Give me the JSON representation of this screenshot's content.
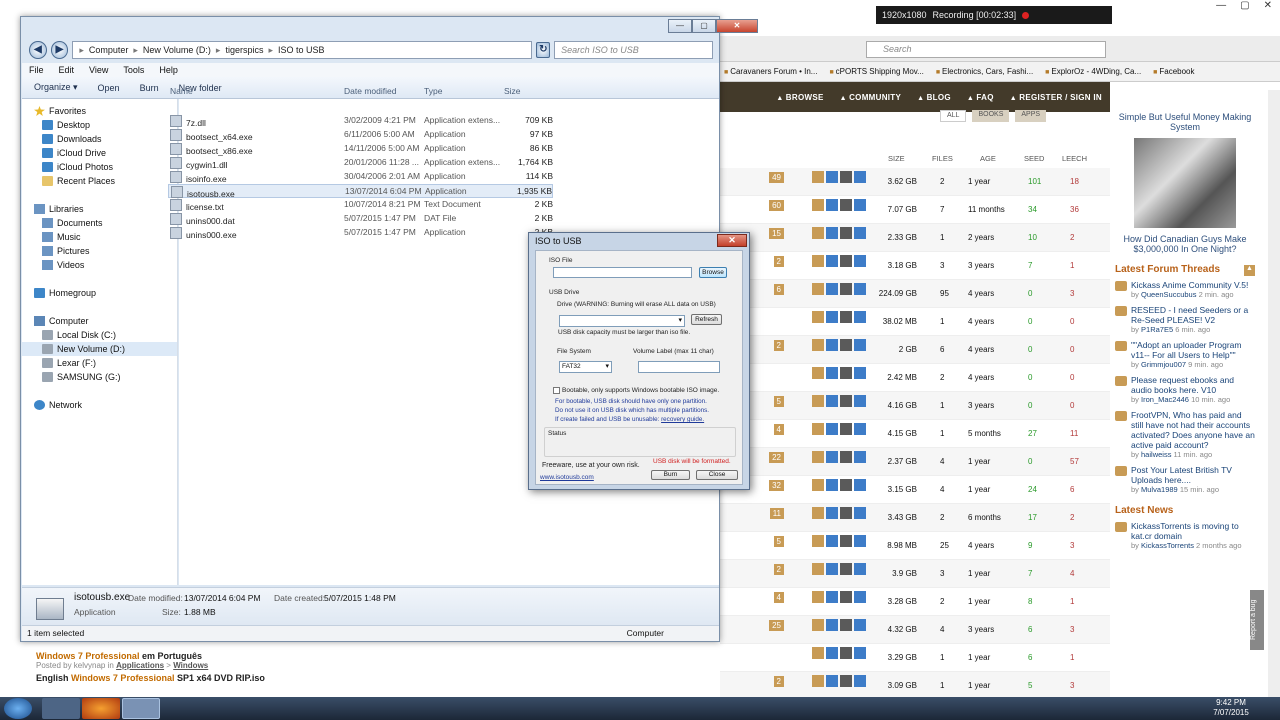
{
  "recorder": {
    "resolution": "1920x1080",
    "recording": "Recording [00:02:33]"
  },
  "browser": {
    "search_placeholder": "Search",
    "bookmarks": [
      "Caravaners Forum • In...",
      "cPORTS Shipping Mov...",
      "Electronics, Cars, Fashi...",
      "ExplorOz - 4WDing, Ca...",
      "Facebook"
    ],
    "nav": [
      "BROWSE",
      "COMMUNITY",
      "BLOG",
      "FAQ",
      "REGISTER / SIGN IN"
    ],
    "tabs": [
      "ALL",
      "BOOKS",
      "APPS"
    ],
    "columns": {
      "size": "SIZE",
      "files": "FILES",
      "age": "AGE",
      "seed": "SEED",
      "leech": "LEECH"
    },
    "torrents": [
      {
        "badge": "49",
        "size": "3.62 GB",
        "files": "2",
        "age": "1 year",
        "seed": "101",
        "leech": "18"
      },
      {
        "badge": "60",
        "size": "7.07 GB",
        "files": "7",
        "age": "11 months",
        "seed": "34",
        "leech": "36"
      },
      {
        "badge": "15",
        "size": "2.33 GB",
        "files": "1",
        "age": "2 years",
        "seed": "10",
        "leech": "2"
      },
      {
        "badge": "2",
        "size": "3.18 GB",
        "files": "3",
        "age": "3 years",
        "seed": "7",
        "leech": "1"
      },
      {
        "badge": "6",
        "size": "224.09 GB",
        "files": "95",
        "age": "4 years",
        "seed": "0",
        "leech": "3"
      },
      {
        "badge": "",
        "size": "38.02 MB",
        "files": "1",
        "age": "4 years",
        "seed": "0",
        "leech": "0"
      },
      {
        "badge": "2",
        "size": "2 GB",
        "files": "6",
        "age": "4 years",
        "seed": "0",
        "leech": "0"
      },
      {
        "badge": "",
        "size": "2.42 MB",
        "files": "2",
        "age": "4 years",
        "seed": "0",
        "leech": "0"
      },
      {
        "badge": "5",
        "size": "4.16 GB",
        "files": "1",
        "age": "3 years",
        "seed": "0",
        "leech": "0"
      },
      {
        "badge": "4",
        "size": "4.15 GB",
        "files": "1",
        "age": "5 months",
        "seed": "27",
        "leech": "11"
      },
      {
        "badge": "22",
        "size": "2.37 GB",
        "files": "4",
        "age": "1 year",
        "seed": "0",
        "leech": "57"
      },
      {
        "badge": "32",
        "size": "3.15 GB",
        "files": "4",
        "age": "1 year",
        "seed": "24",
        "leech": "6"
      },
      {
        "badge": "11",
        "size": "3.43 GB",
        "files": "2",
        "age": "6 months",
        "seed": "17",
        "leech": "2"
      },
      {
        "badge": "5",
        "size": "8.98 MB",
        "files": "25",
        "age": "4 years",
        "seed": "9",
        "leech": "3"
      },
      {
        "badge": "2",
        "size": "3.9 GB",
        "files": "3",
        "age": "1 year",
        "seed": "7",
        "leech": "4"
      },
      {
        "badge": "4",
        "size": "3.28 GB",
        "files": "2",
        "age": "1 year",
        "seed": "8",
        "leech": "1"
      },
      {
        "badge": "25",
        "size": "4.32 GB",
        "files": "4",
        "age": "3 years",
        "seed": "6",
        "leech": "3"
      },
      {
        "badge": "",
        "size": "3.29 GB",
        "files": "1",
        "age": "1 year",
        "seed": "6",
        "leech": "1"
      },
      {
        "badge": "2",
        "size": "3.09 GB",
        "files": "1",
        "age": "1 year",
        "seed": "5",
        "leech": "3"
      }
    ],
    "bottom_items": [
      {
        "title_pre": "",
        "title_hl": "Windows 7 Professional",
        "title_post": " em Português",
        "posted": "Posted by kelvynap in",
        "cat1": "Applications",
        "cat2": "Windows"
      },
      {
        "title_pre": "English ",
        "title_hl": "Windows 7 Professional",
        "title_post": " SP1 x64 DVD RIP.iso",
        "posted": "",
        "cat1": "",
        "cat2": ""
      }
    ],
    "ad": {
      "top": "Simple But Useful Money Making System",
      "bottom": "How Did Canadian Guys Make $3,000,000 In One Night?"
    },
    "forum_heading": "Latest Forum Threads",
    "threads": [
      {
        "title": "Kickass Anime Community V.5!",
        "user": "QueenSuccubus",
        "time": "2 min. ago"
      },
      {
        "title": "RESEED - I need Seeders or a Re-Seed PLEASE! V2",
        "user": "P1Ra7E5",
        "time": "6 min. ago"
      },
      {
        "title": "\"\"Adopt an uploader Program v11-- For all Users to Help\"\"",
        "user": "Grimmjou007",
        "time": "9 min. ago"
      },
      {
        "title": "Please request ebooks and audio books here. V10",
        "user": "Iron_Mac2446",
        "time": "10 min. ago"
      },
      {
        "title": "FrootVPN, Who has paid and still have not had their accounts activated? Does anyone have an active paid account?",
        "user": "hailweiss",
        "time": "11 min. ago"
      },
      {
        "title": "Post Your Latest British TV Uploads here....",
        "user": "Mulva1989",
        "time": "15 min. ago"
      }
    ],
    "news_heading": "Latest News",
    "news": [
      {
        "title": "KickassTorrents is moving to kat.cr domain",
        "user": "KickassTorrents",
        "time": "2 months ago"
      }
    ],
    "report_bug": "Report a bug"
  },
  "explorer": {
    "address": [
      "Computer",
      "New Volume (D:)",
      "tigerspics",
      "ISO to USB"
    ],
    "search_placeholder": "Search ISO to USB",
    "menu": [
      "File",
      "Edit",
      "View",
      "Tools",
      "Help"
    ],
    "toolbar": [
      "Organize ▾",
      "Open",
      "Burn",
      "New folder"
    ],
    "nav": [
      {
        "label": "Favorites",
        "icon": "star-icon",
        "indent": 0
      },
      {
        "label": "Desktop",
        "icon": "desktop-icon",
        "indent": 1
      },
      {
        "label": "Downloads",
        "icon": "downloads-icon",
        "indent": 1
      },
      {
        "label": "iCloud Drive",
        "icon": "cloud-icon",
        "indent": 1
      },
      {
        "label": "iCloud Photos",
        "icon": "cloud-icon",
        "indent": 1
      },
      {
        "label": "Recent Places",
        "icon": "recent-icon",
        "indent": 1
      },
      {
        "label": "",
        "icon": "",
        "indent": 0
      },
      {
        "label": "Libraries",
        "icon": "library-icon",
        "indent": 0
      },
      {
        "label": "Documents",
        "icon": "library-icon",
        "indent": 1
      },
      {
        "label": "Music",
        "icon": "library-icon",
        "indent": 1
      },
      {
        "label": "Pictures",
        "icon": "library-icon",
        "indent": 1
      },
      {
        "label": "Videos",
        "icon": "library-icon",
        "indent": 1
      },
      {
        "label": "",
        "icon": "",
        "indent": 0
      },
      {
        "label": "Homegroup",
        "icon": "homegroup-icon",
        "indent": 0
      },
      {
        "label": "",
        "icon": "",
        "indent": 0
      },
      {
        "label": "Computer",
        "icon": "computer-icon",
        "indent": 0
      },
      {
        "label": "Local Disk (C:)",
        "icon": "drive-icon",
        "indent": 1
      },
      {
        "label": "New Volume (D:)",
        "icon": "drive-icon",
        "indent": 1
      },
      {
        "label": "Lexar (F:)",
        "icon": "drive-icon",
        "indent": 1
      },
      {
        "label": "SAMSUNG (G:)",
        "icon": "drive-icon",
        "indent": 1
      },
      {
        "label": "",
        "icon": "",
        "indent": 0
      },
      {
        "label": "Network",
        "icon": "network-icon",
        "indent": 0
      }
    ],
    "columns": {
      "name": "Name",
      "date": "Date modified",
      "type": "Type",
      "size": "Size"
    },
    "files": [
      {
        "name": "7z.dll",
        "date": "3/02/2009 4:21 PM",
        "type": "Application extens...",
        "size": "709 KB"
      },
      {
        "name": "bootsect_x64.exe",
        "date": "6/11/2006 5:00 AM",
        "type": "Application",
        "size": "97 KB"
      },
      {
        "name": "bootsect_x86.exe",
        "date": "14/11/2006 5:00 AM",
        "type": "Application",
        "size": "86 KB"
      },
      {
        "name": "cygwin1.dll",
        "date": "20/01/2006 11:28 ...",
        "type": "Application extens...",
        "size": "1,764 KB"
      },
      {
        "name": "isoinfo.exe",
        "date": "30/04/2006 2:01 AM",
        "type": "Application",
        "size": "114 KB"
      },
      {
        "name": "isotousb.exe",
        "date": "13/07/2014 6:04 PM",
        "type": "Application",
        "size": "1,935 KB"
      },
      {
        "name": "license.txt",
        "date": "10/07/2014 8:21 PM",
        "type": "Text Document",
        "size": "2 KB"
      },
      {
        "name": "unins000.dat",
        "date": "5/07/2015 1:47 PM",
        "type": "DAT File",
        "size": "2 KB"
      },
      {
        "name": "unins000.exe",
        "date": "5/07/2015 1:47 PM",
        "type": "Application",
        "size": "2 KB"
      }
    ],
    "selected_index": 5,
    "details": {
      "name": "isotousb.exe",
      "kind": "Application",
      "modified_label": "Date modified:",
      "modified": "13/07/2014 6:04 PM",
      "created_label": "Date created:",
      "created": "5/07/2015 1:48 PM",
      "size_label": "Size:",
      "size": "1.88 MB"
    },
    "status": {
      "left": "1 item selected",
      "right": "Computer"
    }
  },
  "dialog": {
    "title": "ISO to USB",
    "iso_file_label": "ISO File",
    "browse": "Browse",
    "usb_drive_label": "USB Drive",
    "drive_warning": "Drive (WARNING: Burning will erase ALL data on USB)",
    "refresh": "Refresh",
    "capacity_note": "USB disk capacity must be larger than iso file.",
    "fs_label": "File System",
    "fs_value": "FAT32",
    "volume_label": "Volume Label (max 11 char)",
    "bootable": "Bootable, only supports Windows bootable ISO image.",
    "note1": "For bootable, USB disk should have only one partition.",
    "note2": "Do not use it on USB disk which has multiple partitions.",
    "note3": "If create failed and USB be unusable:",
    "recovery": "recovery guide.",
    "status_label": "Status",
    "freeware": "Freeware, use at your own risk.",
    "warning": "USB disk will be formatted.",
    "website": "www.isotousb.com",
    "burn": "Burn",
    "close": "Close"
  },
  "taskbar": {
    "time": "9:42 PM",
    "date": "7/07/2015"
  },
  "colors": {
    "accent": "#c89b55",
    "site_nav": "#433a2a",
    "link": "#1a4478",
    "heading": "#b8621a"
  }
}
